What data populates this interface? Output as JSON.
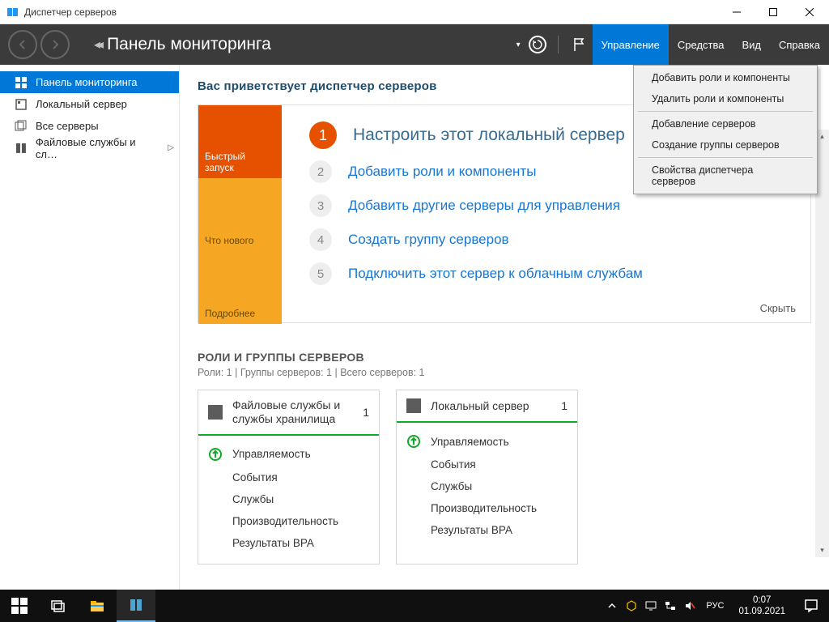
{
  "window": {
    "title": "Диспетчер серверов"
  },
  "header": {
    "breadcrumb": "Панель мониторинга",
    "menu": [
      "Управление",
      "Средства",
      "Вид",
      "Справка"
    ]
  },
  "dropdown": {
    "items": [
      "Добавить роли и компоненты",
      "Удалить роли и компоненты",
      "Добавление серверов",
      "Создание группы серверов",
      "Свойства диспетчера серверов"
    ]
  },
  "sidebar": {
    "items": [
      {
        "label": "Панель мониторинга"
      },
      {
        "label": "Локальный сервер"
      },
      {
        "label": "Все серверы"
      },
      {
        "label": "Файловые службы и сл…"
      }
    ]
  },
  "welcome": {
    "title": "Вас приветствует диспетчер серверов",
    "tiles": {
      "quick": "Быстрый запуск",
      "new": "Что нового",
      "more": "Подробнее"
    },
    "steps": [
      "Настроить этот локальный сервер",
      "Добавить роли и компоненты",
      "Добавить другие серверы для управления",
      "Создать группу серверов",
      "Подключить этот сервер к облачным службам"
    ],
    "hide": "Скрыть"
  },
  "roles": {
    "heading": "РОЛИ И ГРУППЫ СЕРВЕРОВ",
    "sub": "Роли: 1 | Группы серверов: 1 | Всего серверов: 1",
    "cards": [
      {
        "title": "Файловые службы и службы хранилища",
        "count": "1",
        "rows": [
          "Управляемость",
          "События",
          "Службы",
          "Производительность",
          "Результаты BPA"
        ]
      },
      {
        "title": "Локальный сервер",
        "count": "1",
        "rows": [
          "Управляемость",
          "События",
          "Службы",
          "Производительность",
          "Результаты BPA"
        ]
      }
    ]
  },
  "taskbar": {
    "lang": "РУС",
    "time": "0:07",
    "date": "01.09.2021"
  }
}
